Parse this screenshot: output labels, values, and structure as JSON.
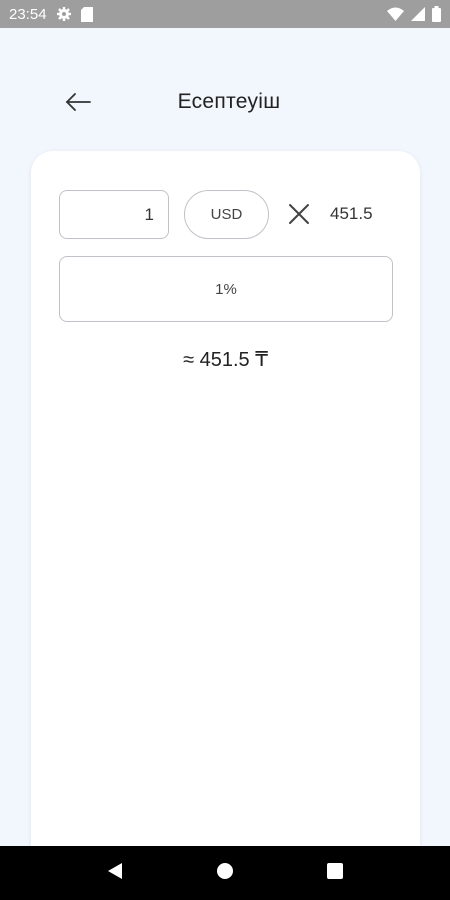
{
  "status_bar": {
    "time": "23:54",
    "icons": [
      "gear-icon",
      "sd-card-icon",
      "wifi-icon",
      "signal-icon",
      "battery-icon"
    ]
  },
  "header": {
    "title": "Есептеуіш",
    "back_icon": "arrow-left-icon"
  },
  "calculator": {
    "amount_value": "1",
    "currency": "USD",
    "multiply_icon": "close-x-icon",
    "rate": "451.5",
    "fee": "1%",
    "result": "≈ 451.5 ₸"
  },
  "nav_bar": {
    "icons": [
      "back-triangle-icon",
      "home-circle-icon",
      "recents-square-icon"
    ]
  },
  "colors": {
    "background": "#f2f7fd",
    "card": "#ffffff",
    "border": "#bfc3c8",
    "status_bar": "#9e9e9e",
    "nav_bar": "#000000"
  }
}
